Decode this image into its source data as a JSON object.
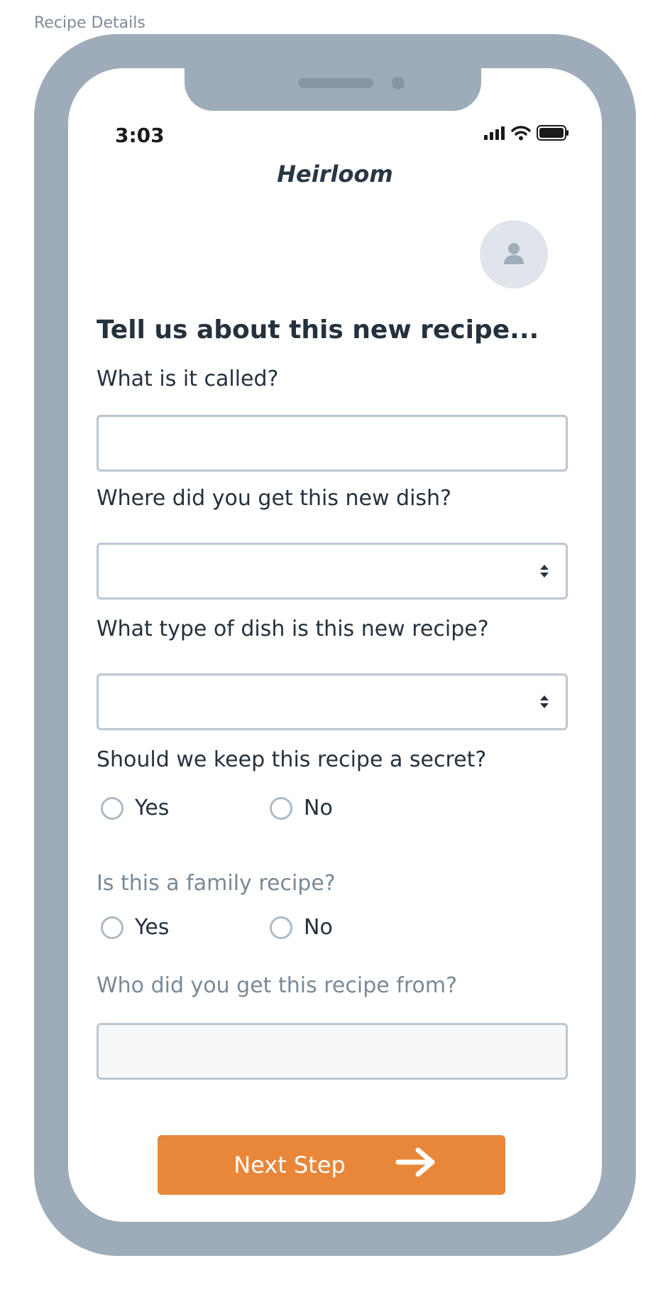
{
  "page_label": "Recipe Details",
  "status_bar": {
    "time": "3:03"
  },
  "app": {
    "title": "Heirloom"
  },
  "form": {
    "heading": "Tell us about this new recipe...",
    "name_question": "What is it called?",
    "name_value": "",
    "source_question": "Where did you get this new dish?",
    "source_value": "",
    "type_question": "What type of dish is this new recipe?",
    "type_value": "",
    "secret_question": "Should we keep this recipe a secret?",
    "secret_options": [
      "Yes",
      "No"
    ],
    "family_question": "Is this a family recipe?",
    "family_options": [
      "Yes",
      "No"
    ],
    "from_question": "Who did you get this recipe from?",
    "from_value": ""
  },
  "next_button": {
    "label": "Next Step",
    "color": "#E8873A"
  },
  "icons": [
    "signal-icon",
    "wifi-icon",
    "battery-icon",
    "user-icon",
    "select-arrows-icon",
    "arrow-right-icon"
  ]
}
